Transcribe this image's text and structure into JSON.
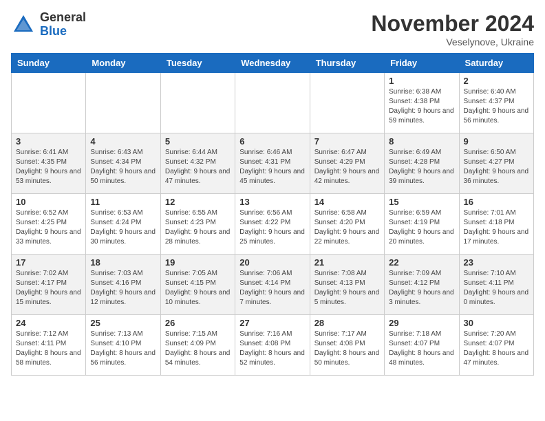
{
  "logo": {
    "general": "General",
    "blue": "Blue"
  },
  "title": "November 2024",
  "location": "Veselynove, Ukraine",
  "days_of_week": [
    "Sunday",
    "Monday",
    "Tuesday",
    "Wednesday",
    "Thursday",
    "Friday",
    "Saturday"
  ],
  "weeks": [
    [
      {
        "day": "",
        "info": ""
      },
      {
        "day": "",
        "info": ""
      },
      {
        "day": "",
        "info": ""
      },
      {
        "day": "",
        "info": ""
      },
      {
        "day": "",
        "info": ""
      },
      {
        "day": "1",
        "info": "Sunrise: 6:38 AM\nSunset: 4:38 PM\nDaylight: 9 hours and 59 minutes."
      },
      {
        "day": "2",
        "info": "Sunrise: 6:40 AM\nSunset: 4:37 PM\nDaylight: 9 hours and 56 minutes."
      }
    ],
    [
      {
        "day": "3",
        "info": "Sunrise: 6:41 AM\nSunset: 4:35 PM\nDaylight: 9 hours and 53 minutes."
      },
      {
        "day": "4",
        "info": "Sunrise: 6:43 AM\nSunset: 4:34 PM\nDaylight: 9 hours and 50 minutes."
      },
      {
        "day": "5",
        "info": "Sunrise: 6:44 AM\nSunset: 4:32 PM\nDaylight: 9 hours and 47 minutes."
      },
      {
        "day": "6",
        "info": "Sunrise: 6:46 AM\nSunset: 4:31 PM\nDaylight: 9 hours and 45 minutes."
      },
      {
        "day": "7",
        "info": "Sunrise: 6:47 AM\nSunset: 4:29 PM\nDaylight: 9 hours and 42 minutes."
      },
      {
        "day": "8",
        "info": "Sunrise: 6:49 AM\nSunset: 4:28 PM\nDaylight: 9 hours and 39 minutes."
      },
      {
        "day": "9",
        "info": "Sunrise: 6:50 AM\nSunset: 4:27 PM\nDaylight: 9 hours and 36 minutes."
      }
    ],
    [
      {
        "day": "10",
        "info": "Sunrise: 6:52 AM\nSunset: 4:25 PM\nDaylight: 9 hours and 33 minutes."
      },
      {
        "day": "11",
        "info": "Sunrise: 6:53 AM\nSunset: 4:24 PM\nDaylight: 9 hours and 30 minutes."
      },
      {
        "day": "12",
        "info": "Sunrise: 6:55 AM\nSunset: 4:23 PM\nDaylight: 9 hours and 28 minutes."
      },
      {
        "day": "13",
        "info": "Sunrise: 6:56 AM\nSunset: 4:22 PM\nDaylight: 9 hours and 25 minutes."
      },
      {
        "day": "14",
        "info": "Sunrise: 6:58 AM\nSunset: 4:20 PM\nDaylight: 9 hours and 22 minutes."
      },
      {
        "day": "15",
        "info": "Sunrise: 6:59 AM\nSunset: 4:19 PM\nDaylight: 9 hours and 20 minutes."
      },
      {
        "day": "16",
        "info": "Sunrise: 7:01 AM\nSunset: 4:18 PM\nDaylight: 9 hours and 17 minutes."
      }
    ],
    [
      {
        "day": "17",
        "info": "Sunrise: 7:02 AM\nSunset: 4:17 PM\nDaylight: 9 hours and 15 minutes."
      },
      {
        "day": "18",
        "info": "Sunrise: 7:03 AM\nSunset: 4:16 PM\nDaylight: 9 hours and 12 minutes."
      },
      {
        "day": "19",
        "info": "Sunrise: 7:05 AM\nSunset: 4:15 PM\nDaylight: 9 hours and 10 minutes."
      },
      {
        "day": "20",
        "info": "Sunrise: 7:06 AM\nSunset: 4:14 PM\nDaylight: 9 hours and 7 minutes."
      },
      {
        "day": "21",
        "info": "Sunrise: 7:08 AM\nSunset: 4:13 PM\nDaylight: 9 hours and 5 minutes."
      },
      {
        "day": "22",
        "info": "Sunrise: 7:09 AM\nSunset: 4:12 PM\nDaylight: 9 hours and 3 minutes."
      },
      {
        "day": "23",
        "info": "Sunrise: 7:10 AM\nSunset: 4:11 PM\nDaylight: 9 hours and 0 minutes."
      }
    ],
    [
      {
        "day": "24",
        "info": "Sunrise: 7:12 AM\nSunset: 4:11 PM\nDaylight: 8 hours and 58 minutes."
      },
      {
        "day": "25",
        "info": "Sunrise: 7:13 AM\nSunset: 4:10 PM\nDaylight: 8 hours and 56 minutes."
      },
      {
        "day": "26",
        "info": "Sunrise: 7:15 AM\nSunset: 4:09 PM\nDaylight: 8 hours and 54 minutes."
      },
      {
        "day": "27",
        "info": "Sunrise: 7:16 AM\nSunset: 4:08 PM\nDaylight: 8 hours and 52 minutes."
      },
      {
        "day": "28",
        "info": "Sunrise: 7:17 AM\nSunset: 4:08 PM\nDaylight: 8 hours and 50 minutes."
      },
      {
        "day": "29",
        "info": "Sunrise: 7:18 AM\nSunset: 4:07 PM\nDaylight: 8 hours and 48 minutes."
      },
      {
        "day": "30",
        "info": "Sunrise: 7:20 AM\nSunset: 4:07 PM\nDaylight: 8 hours and 47 minutes."
      }
    ]
  ]
}
